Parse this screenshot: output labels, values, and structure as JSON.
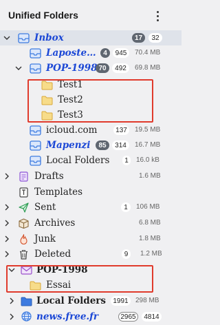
{
  "header": {
    "title": "Unified Folders",
    "menu_icon": "more-vertical-icon"
  },
  "colors": {
    "account_text": "#1c48d6",
    "highlight_border": "#e03a2c",
    "unread_badge": "#5f6670",
    "folder_yellow": "#f3cf6b",
    "inbox_blue": "#3d7be0"
  },
  "folders": {
    "inbox": {
      "label": "Inbox",
      "unread": "17",
      "total": "32"
    },
    "laposte": {
      "label": "Laposte…",
      "unread": "4",
      "total": "945",
      "size": "70.4 MB"
    },
    "pop1998_inbox": {
      "label": "POP-1998",
      "unread": "70",
      "total": "492",
      "size": "69.8 MB"
    },
    "test1": {
      "label": "Test1"
    },
    "test2": {
      "label": "Test2"
    },
    "test3": {
      "label": "Test3"
    },
    "icloud": {
      "label": "icloud.com",
      "total": "137",
      "size": "19.5 MB"
    },
    "mapenzi": {
      "label": "Mapenzi",
      "unread": "85",
      "total": "314",
      "size": "16.7 MB"
    },
    "local_inbox": {
      "label": "Local Folders",
      "total": "1",
      "size": "16.0 kB"
    },
    "drafts": {
      "label": "Drafts",
      "size": "1.6 MB"
    },
    "templates": {
      "label": "Templates"
    },
    "sent": {
      "label": "Sent",
      "total": "1",
      "size": "106 MB"
    },
    "archives": {
      "label": "Archives",
      "size": "6.8 MB"
    },
    "junk": {
      "label": "Junk",
      "size": "1.8 MB"
    },
    "deleted": {
      "label": "Deleted",
      "unread": "9",
      "size": "1.2 MB"
    },
    "pop1998_account": {
      "label": "POP-1998"
    },
    "essai": {
      "label": "Essai"
    },
    "local_folders": {
      "label": "Local Folders",
      "total": "1991",
      "size": "298 MB"
    },
    "newsfree": {
      "label": "news.free.fr",
      "unread": "2965",
      "total": "4814"
    }
  }
}
